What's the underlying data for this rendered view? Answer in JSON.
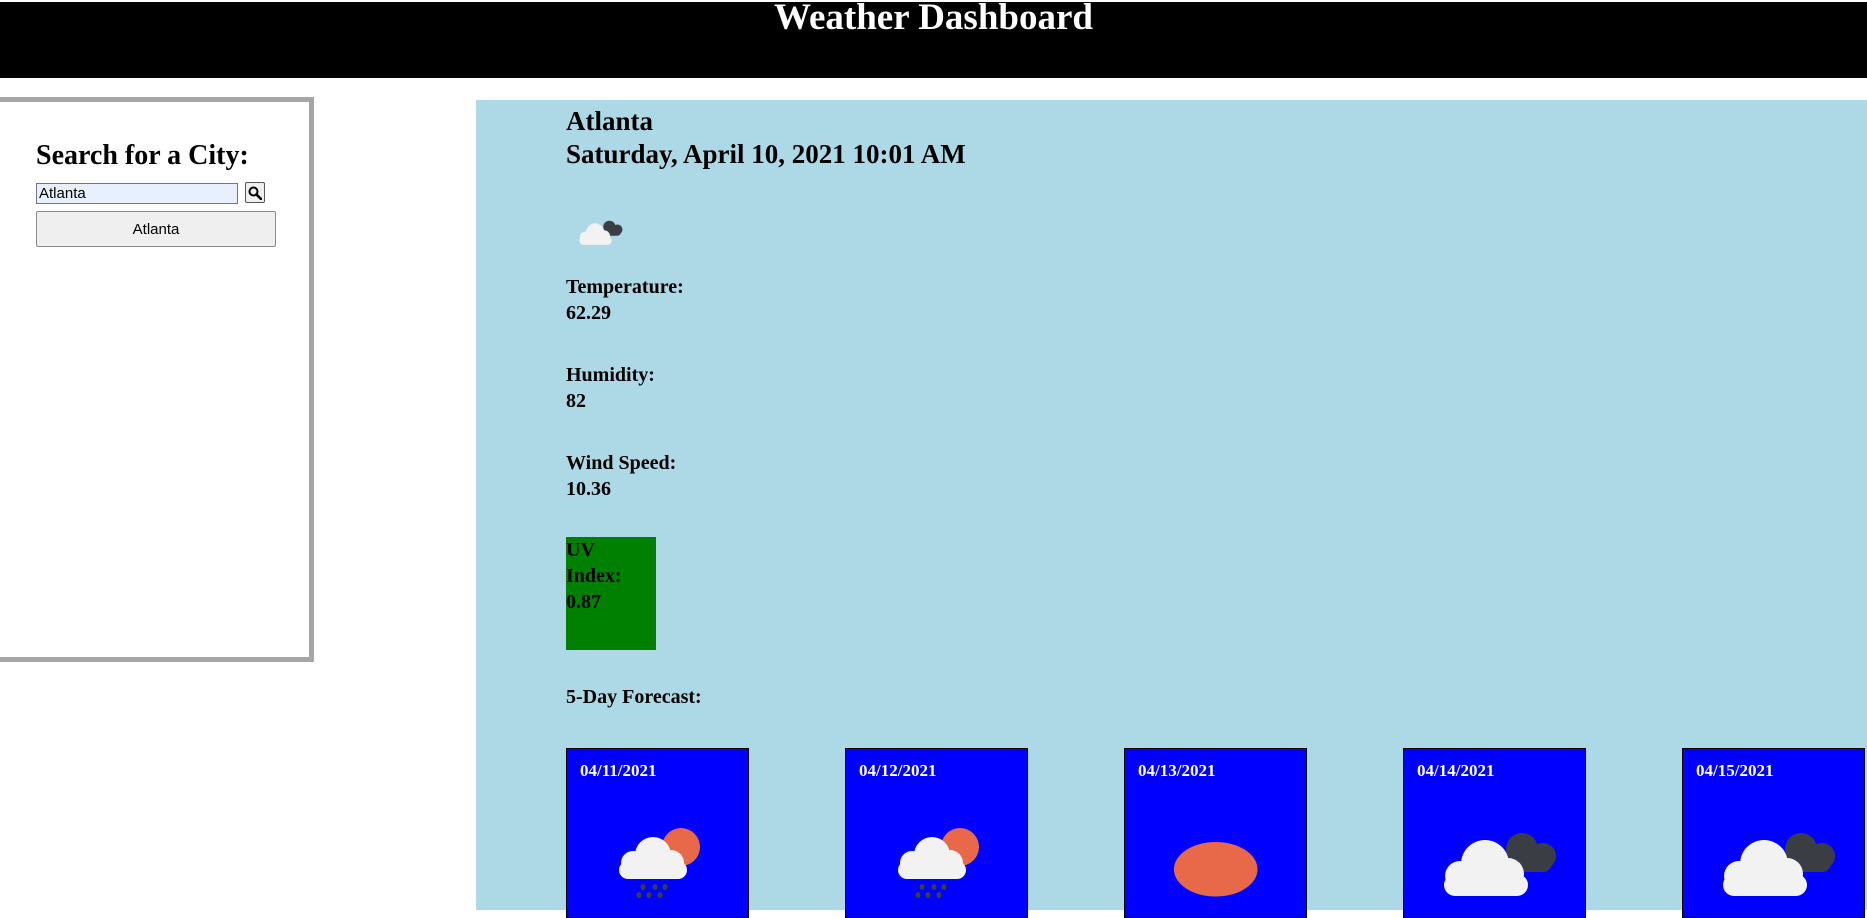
{
  "header": {
    "title": "Weather Dashboard"
  },
  "search": {
    "heading": "Search for a City:",
    "input_value": "Atlanta",
    "history": [
      "Atlanta"
    ]
  },
  "current": {
    "city": "Atlanta",
    "datetime": "Saturday, April 10, 2021 10:01 AM",
    "icon": "cloudy-icon",
    "temperature_label": "Temperature:",
    "temperature": "62.29",
    "humidity_label": "Humidity:",
    "humidity": "82",
    "wind_label": "Wind Speed:",
    "wind": "10.36",
    "uv_label_1": "UV",
    "uv_label_2": "Index:",
    "uv_value": "0.87",
    "uv_color": "#008000"
  },
  "forecast": {
    "title": "5-Day Forecast:",
    "days": [
      {
        "date": "04/11/2021",
        "icon": "rain-sun-icon"
      },
      {
        "date": "04/12/2021",
        "icon": "rain-sun-icon"
      },
      {
        "date": "04/13/2021",
        "icon": "sun-icon"
      },
      {
        "date": "04/14/2021",
        "icon": "cloudy-icon"
      },
      {
        "date": "04/15/2021",
        "icon": "cloudy-icon"
      }
    ]
  },
  "colors": {
    "header_bg": "#000000",
    "main_bg": "#add8e6",
    "card_bg": "#0000ff",
    "sidebar_border": "#a6a6a6"
  }
}
